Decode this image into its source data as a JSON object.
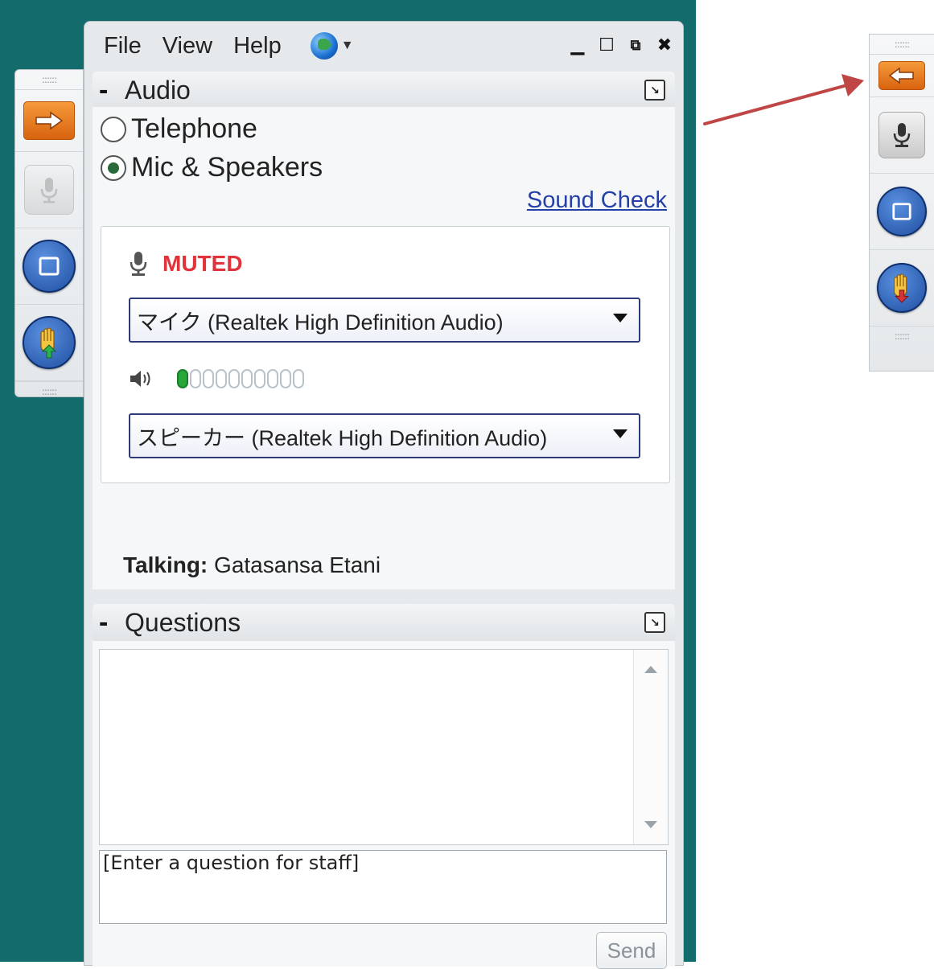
{
  "menu": {
    "file": "File",
    "view": "View",
    "help": "Help"
  },
  "audio": {
    "title": "Audio",
    "option_telephone": "Telephone",
    "option_mic": "Mic & Speakers",
    "selected_option": "Mic & Speakers",
    "sound_check": "Sound Check",
    "mute_status": "MUTED",
    "mic_device": "マイク (Realtek High Definition Audio)",
    "speaker_device": "スピーカー (Realtek High Definition Audio)",
    "speaker_level_segments_lit": 1,
    "speaker_level_segments_total": 10,
    "talking_label": "Talking:",
    "talking_name": "Gatasansa Etani"
  },
  "questions": {
    "title": "Questions",
    "input_value": "[Enter a question for staff]",
    "send_label": "Send"
  },
  "colors": {
    "background_teal": "#136b6b",
    "accent_orange": "#e8761f",
    "muted_red": "#e0333a",
    "link_blue": "#2440a6",
    "arrow_red": "#c04646"
  },
  "icons": [
    "grip-icon",
    "arrow-right-icon",
    "arrow-left-icon",
    "microphone-icon",
    "screen-icon",
    "raise-hand-icon",
    "lower-hand-icon",
    "globe-icon",
    "minimize-icon",
    "maximize-icon",
    "restore-icon",
    "close-icon",
    "popout-icon",
    "speaker-icon",
    "chevron-down-icon",
    "scroll-up-icon",
    "scroll-down-icon"
  ]
}
